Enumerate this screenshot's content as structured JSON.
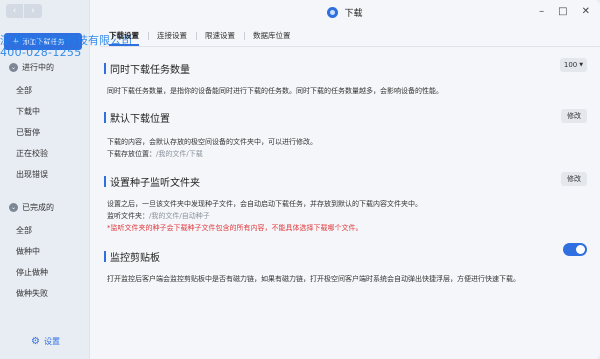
{
  "window": {
    "title": "下载"
  },
  "sidebar": {
    "add_task_label": "添加下载任务",
    "watermark_line1": "深圳市极空间科技有限公司",
    "watermark_line2": "400-028-1255",
    "groups": [
      {
        "label": "进行中的",
        "items": [
          "全部",
          "下载中",
          "已暂停",
          "正在校验",
          "出现错误"
        ]
      },
      {
        "label": "已完成的",
        "items": [
          "全部",
          "做种中",
          "停止做种",
          "做种失败"
        ]
      }
    ],
    "settings_label": "设置"
  },
  "tabs": [
    "下载设置",
    "连接设置",
    "限速设置",
    "数据库位置"
  ],
  "active_tab": 0,
  "sections": {
    "concurrent": {
      "title": "同时下载任务数量",
      "desc": "同时下载任务数量，是指你的设备能同时进行下载的任务数。同时下载的任务数量越多，会影响设备的性能。",
      "select_value": "100"
    },
    "default_location": {
      "title": "默认下载位置",
      "desc": "下载的内容，会默认存放的极空间设备的文件夹中，可以进行修改。",
      "path_label": "下载存放位置：",
      "path_value": "/我的文件/下载",
      "button": "修改"
    },
    "watch_folder": {
      "title": "设置种子监听文件夹",
      "desc": "设置之后，一旦该文件夹中发现种子文件，会自动启动下载任务，并存放到默认的下载内容文件夹中。",
      "path_label": "监听文件夹：",
      "path_value": "/我的文件/自动种子",
      "warning": "*监听文件夹的种子会下载种子文件包含的所有内容，不能具体选择下载哪个文件。",
      "button": "修改"
    },
    "clipboard": {
      "title": "监控剪贴板",
      "desc": "打开监控后客户端会监控剪贴板中是否有磁力链，如果有磁力链，打开极空间客户端时系统会自动弹出快捷浮层，方便进行快速下载。",
      "enabled": true
    }
  },
  "colors": {
    "accent": "#2f6fe0",
    "warning": "#e0393e"
  }
}
